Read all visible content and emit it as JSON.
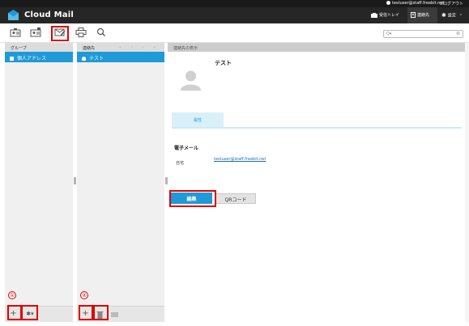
{
  "topstrip": {
    "user_email": "testuser@staff.freebit.net",
    "logout_label": "ログアウト"
  },
  "app": {
    "brand": "Cloud Mail"
  },
  "nav": {
    "inbox_label": "受信トレイ",
    "contacts_label": "連絡先",
    "settings_label": "設定"
  },
  "search": {
    "placeholder": "Q▾"
  },
  "groups": {
    "header": "グループ",
    "items": [
      {
        "label": "個人アドレス"
      }
    ],
    "badge": "①"
  },
  "contacts": {
    "header": "連絡先",
    "pager": "« ‹ › »",
    "items": [
      {
        "label": "テスト"
      }
    ],
    "badge": "②"
  },
  "detail": {
    "header": "連絡先の表示",
    "name": "テスト",
    "tab_label": "属性",
    "section_email": "電子メール",
    "field_label": "自宅",
    "field_value": "testuser@staff.freebit.net",
    "edit_label": "編集",
    "qr_label": "QRコード"
  },
  "icons": {
    "compose": "mail-edit-icon",
    "print": "printer-icon",
    "search": "search-icon",
    "add": "plus-icon",
    "gear": "gear-icon",
    "delete": "trash-icon"
  },
  "colors": {
    "accent": "#1e9ad8",
    "highlight": "#e00000",
    "appbar": "#262626"
  }
}
